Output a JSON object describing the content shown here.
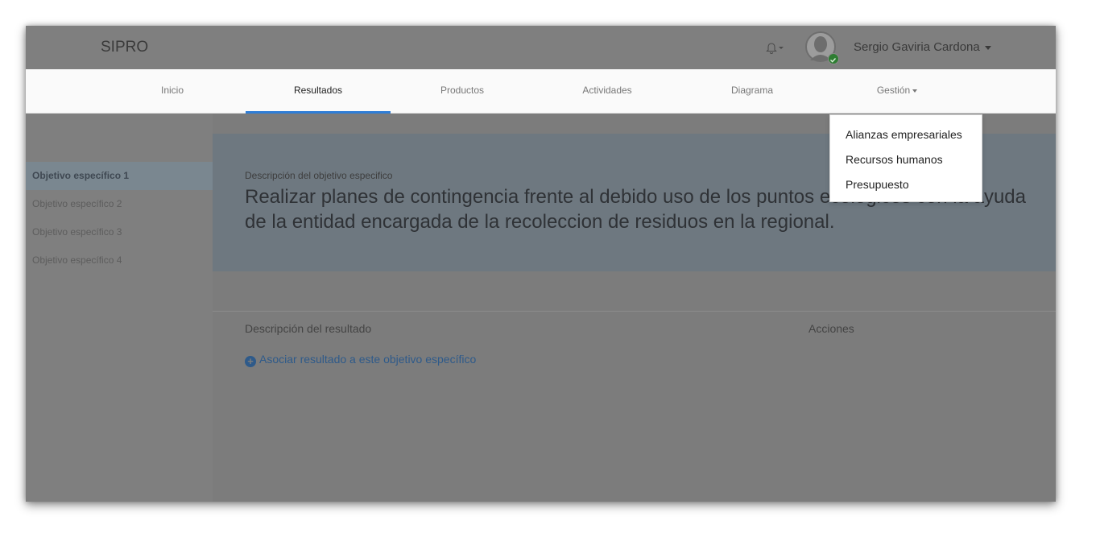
{
  "app": {
    "brand": "SIPRO"
  },
  "header": {
    "user_name": "Sergio Gaviria Cardona"
  },
  "nav": {
    "tabs": [
      {
        "label": "Inicio"
      },
      {
        "label": "Resultados"
      },
      {
        "label": "Productos"
      },
      {
        "label": "Actividades"
      },
      {
        "label": "Diagrama"
      },
      {
        "label": "Gestión"
      }
    ]
  },
  "dropdown": {
    "items": [
      {
        "label": "Alianzas empresariales"
      },
      {
        "label": "Recursos humanos"
      },
      {
        "label": "Presupuesto"
      }
    ]
  },
  "sidebar": {
    "items": [
      {
        "label": "Objetivo específico 1"
      },
      {
        "label": "Objetivo específico 2"
      },
      {
        "label": "Objetivo específico 3"
      },
      {
        "label": "Objetivo específico 4"
      }
    ]
  },
  "objective": {
    "label": "Descripción del objetivo especifico",
    "text": "Realizar planes de contingencia frente al debido uso de los puntos ecológicos con la ayuda de la entidad encargada de la recoleccion de residuos en la regional."
  },
  "results": {
    "col_description": "Descripción del resultado",
    "col_actions": "Acciones",
    "associate_link": "Asociar resultado a este objetivo específico"
  },
  "colors": {
    "accent": "#2f7dd6",
    "link": "#2e5a8a",
    "status_online": "#2e7d32"
  }
}
